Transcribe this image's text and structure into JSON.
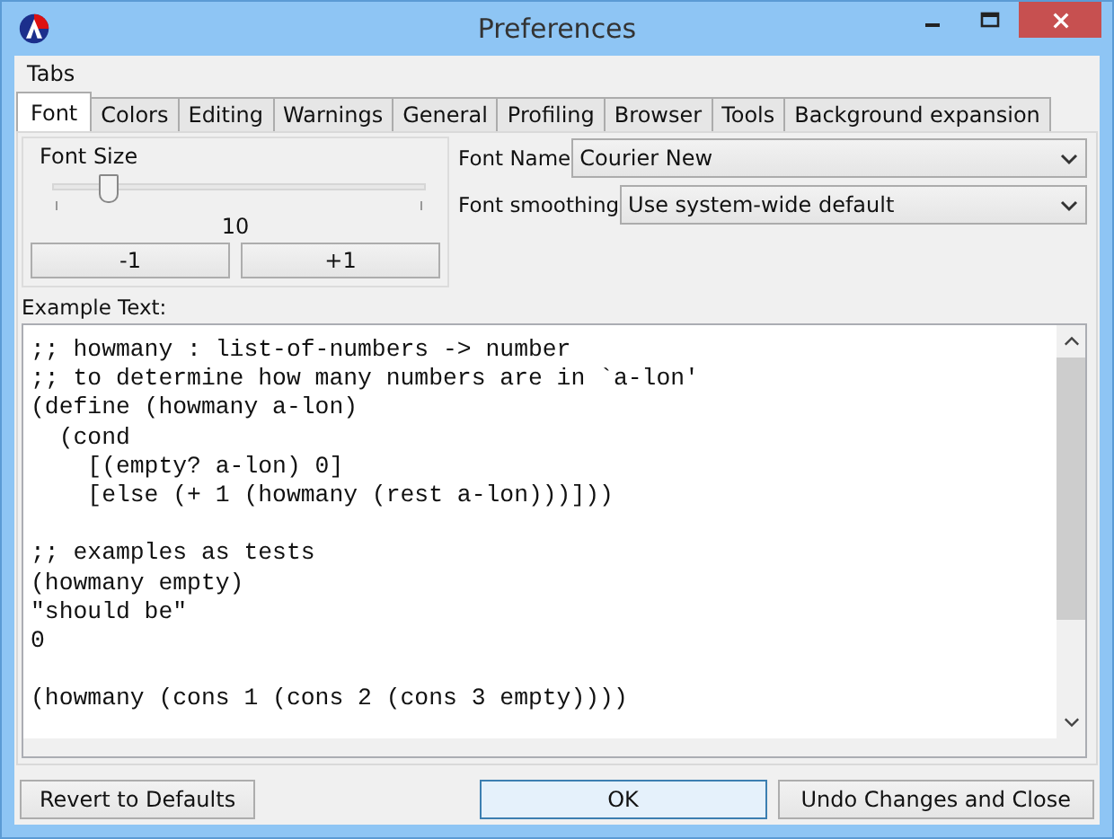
{
  "window": {
    "title": "Preferences"
  },
  "menu": [
    "Tabs"
  ],
  "tabs": [
    {
      "label": "Font",
      "selected": true
    },
    {
      "label": "Colors",
      "selected": false
    },
    {
      "label": "Editing",
      "selected": false
    },
    {
      "label": "Warnings",
      "selected": false
    },
    {
      "label": "General",
      "selected": false
    },
    {
      "label": "Profiling",
      "selected": false
    },
    {
      "label": "Browser",
      "selected": false
    },
    {
      "label": "Tools",
      "selected": false
    },
    {
      "label": "Background expansion",
      "selected": false
    }
  ],
  "font_size": {
    "title": "Font Size",
    "level": 0.14,
    "value": "10",
    "buttons": [
      "-1",
      "+1"
    ]
  },
  "font_name": {
    "label": "Font Name",
    "value": "Courier New"
  },
  "font_smoothing": {
    "label": "Font smoothing",
    "value": "Use system-wide default"
  },
  "example": {
    "label": "Example Text:",
    "text": ";; howmany : list-of-numbers -> number\n;; to determine how many numbers are in `a-lon'\n(define (howmany a-lon)\n  (cond\n    [(empty? a-lon) 0]\n    [else (+ 1 (howmany (rest a-lon)))]))\n\n;; examples as tests\n(howmany empty)\n\"should be\"\n0\n\n(howmany (cons 1 (cons 2 (cons 3 empty))))"
  },
  "buttons": [
    {
      "label": "Revert to Defaults",
      "kind": "plain"
    },
    {
      "label": "OK",
      "kind": "default"
    },
    {
      "label": "Undo Changes and Close",
      "kind": "plain"
    }
  ]
}
